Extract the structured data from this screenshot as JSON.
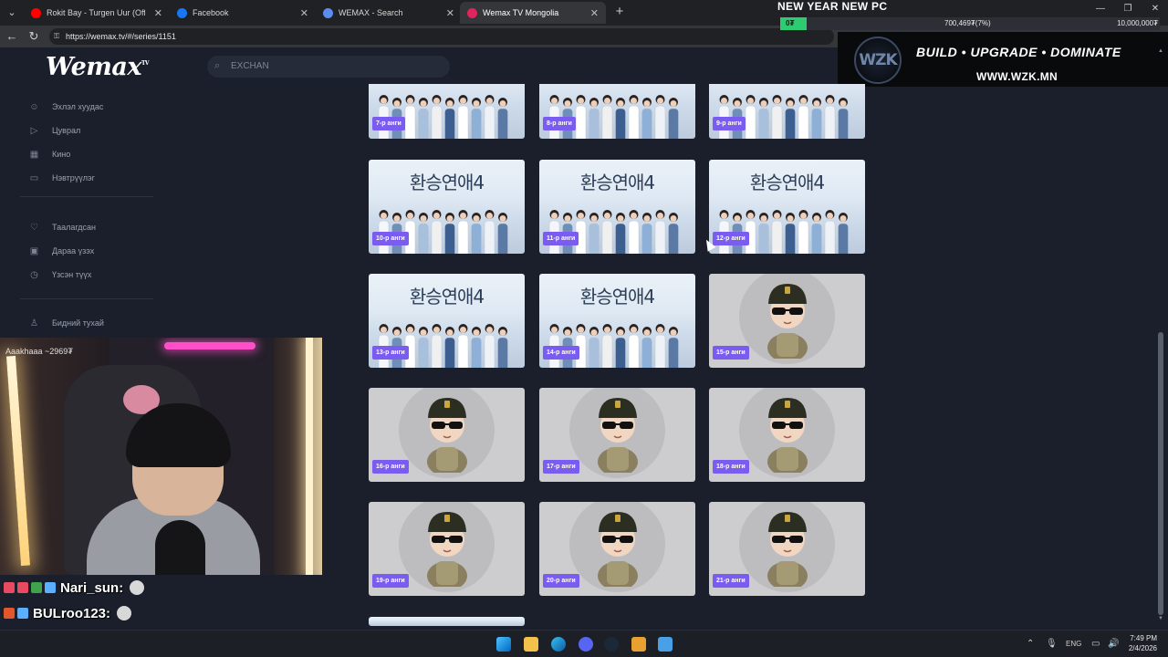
{
  "browser": {
    "tabs": [
      {
        "title": "Rokit Bay - Turgen Uur (Offici",
        "active": false,
        "favicon": "youtube-icon"
      },
      {
        "title": "Facebook",
        "active": false,
        "favicon": "facebook-icon"
      },
      {
        "title": "WEMAX - Search",
        "active": false,
        "favicon": "search-icon"
      },
      {
        "title": "Wemax TV Mongolia",
        "active": true,
        "favicon": "wemax-icon"
      }
    ],
    "url": "https://wemax.tv/#/series/1151"
  },
  "overlay": {
    "new_year": "NEW YEAR NEW PC",
    "goal_start": "0₮",
    "goal_progress": "700,469₮(7%)",
    "goal_target": "10,000,000₮",
    "goal_fraction": 0.07,
    "banner_logo": "WZK",
    "banner_tagline": "BUILD • UPGRADE • DOMINATE",
    "banner_url": "WWW.WZK.MN"
  },
  "site": {
    "logo": "Wemax",
    "logo_tm": "TV",
    "search_placeholder": "EXCHAN",
    "nav": [
      {
        "label": "Эхлэл хуудас",
        "icon": "smile-icon"
      },
      {
        "label": "Цуврал",
        "icon": "play-icon"
      },
      {
        "label": "Кино",
        "icon": "film-icon"
      },
      {
        "label": "Нэвтрүүлэг",
        "icon": "camera-icon"
      }
    ],
    "nav_secondary": [
      {
        "label": "Таалагдсан",
        "icon": "heart-icon"
      },
      {
        "label": "Дараа үзэх",
        "icon": "bookmark-icon"
      },
      {
        "label": "Үзсэн түүх",
        "icon": "clock-icon"
      }
    ],
    "nav_about": {
      "label": "Бидний тухай",
      "icon": "user-icon"
    }
  },
  "episodes": [
    {
      "label": "7-р анги",
      "art": "poster",
      "show_title": false
    },
    {
      "label": "8-р анги",
      "art": "poster",
      "show_title": false
    },
    {
      "label": "9-р анги",
      "art": "poster",
      "show_title": false
    },
    {
      "label": "10-р анги",
      "art": "poster",
      "show_title": true
    },
    {
      "label": "11-р анги",
      "art": "poster",
      "show_title": true
    },
    {
      "label": "12-р анги",
      "art": "poster",
      "show_title": true
    },
    {
      "label": "13-р анги",
      "art": "poster",
      "show_title": true
    },
    {
      "label": "14-р анги",
      "art": "poster",
      "show_title": true
    },
    {
      "label": "15-р анги",
      "art": "avatar",
      "show_title": false
    },
    {
      "label": "16-р анги",
      "art": "avatar",
      "show_title": false
    },
    {
      "label": "17-р анги",
      "art": "avatar",
      "show_title": false
    },
    {
      "label": "18-р анги",
      "art": "avatar",
      "show_title": false
    },
    {
      "label": "19-р анги",
      "art": "avatar",
      "show_title": false
    },
    {
      "label": "20-р анги",
      "art": "avatar",
      "show_title": false
    },
    {
      "label": "21-р анги",
      "art": "avatar",
      "show_title": false
    }
  ],
  "poster_title": "환승연애4",
  "webcam": {
    "overlay_name": "Aaakhaaa ~2969₮"
  },
  "chat": [
    {
      "name": "Nari_sun:",
      "badges": [
        "#e84a5f",
        "#e84a5f",
        "#3fa34d",
        "#5ab0ff"
      ]
    },
    {
      "name": "BULroo123:",
      "badges": [
        "#e2572b",
        "#5ab0ff"
      ]
    },
    {
      "name": "BULroo123:",
      "badges": [
        "#e2572b",
        "#5ab0ff"
      ]
    }
  ],
  "taskbar": {
    "lang": "ENG",
    "time": "7:49 PM",
    "date": "2/4/2026"
  }
}
